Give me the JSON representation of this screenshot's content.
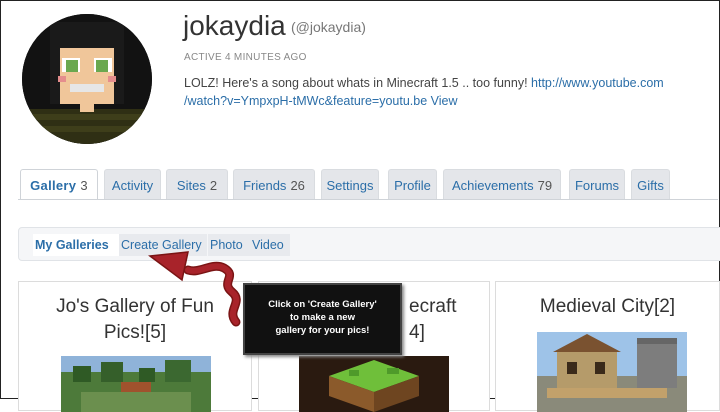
{
  "profile": {
    "username": "jokaydia",
    "handle": "(@jokaydia)",
    "active_status": "ACTIVE 4 MINUTES AGO",
    "status_text": "LOLZ! Here's a song about whats in Minecraft 1.5 .. too funny! ",
    "status_link": "http://www.youtube.com /watch?v=YmpxpH-tMWc&feature=youtu.be",
    "status_view": "View"
  },
  "tabs": [
    {
      "label": "Gallery",
      "count": "3"
    },
    {
      "label": "Activity",
      "count": ""
    },
    {
      "label": "Sites",
      "count": "2"
    },
    {
      "label": "Friends",
      "count": "26"
    },
    {
      "label": "Settings",
      "count": ""
    },
    {
      "label": "Profile",
      "count": ""
    },
    {
      "label": "Achievements",
      "count": "79"
    },
    {
      "label": "Forums",
      "count": ""
    },
    {
      "label": "Gifts",
      "count": ""
    }
  ],
  "subnav": {
    "my_galleries": "My Galleries",
    "create_gallery": "Create Gallery",
    "photo": "Photo",
    "video": "Video"
  },
  "galleries": [
    {
      "title_line1": "Jo's Gallery of Fun",
      "title_line2": "Pics![5]"
    },
    {
      "title_line1": "ecraft",
      "title_line2": "4]"
    },
    {
      "title_line1": "Medieval City[2]",
      "title_line2": ""
    }
  ],
  "callout": {
    "line1": "Click on 'Create Gallery'",
    "line2": "to make a new",
    "line3": "gallery for your pics!"
  },
  "colors": {
    "link": "#2b6ea8",
    "arrow": "#a8232a",
    "callout_bg": "#111111"
  }
}
